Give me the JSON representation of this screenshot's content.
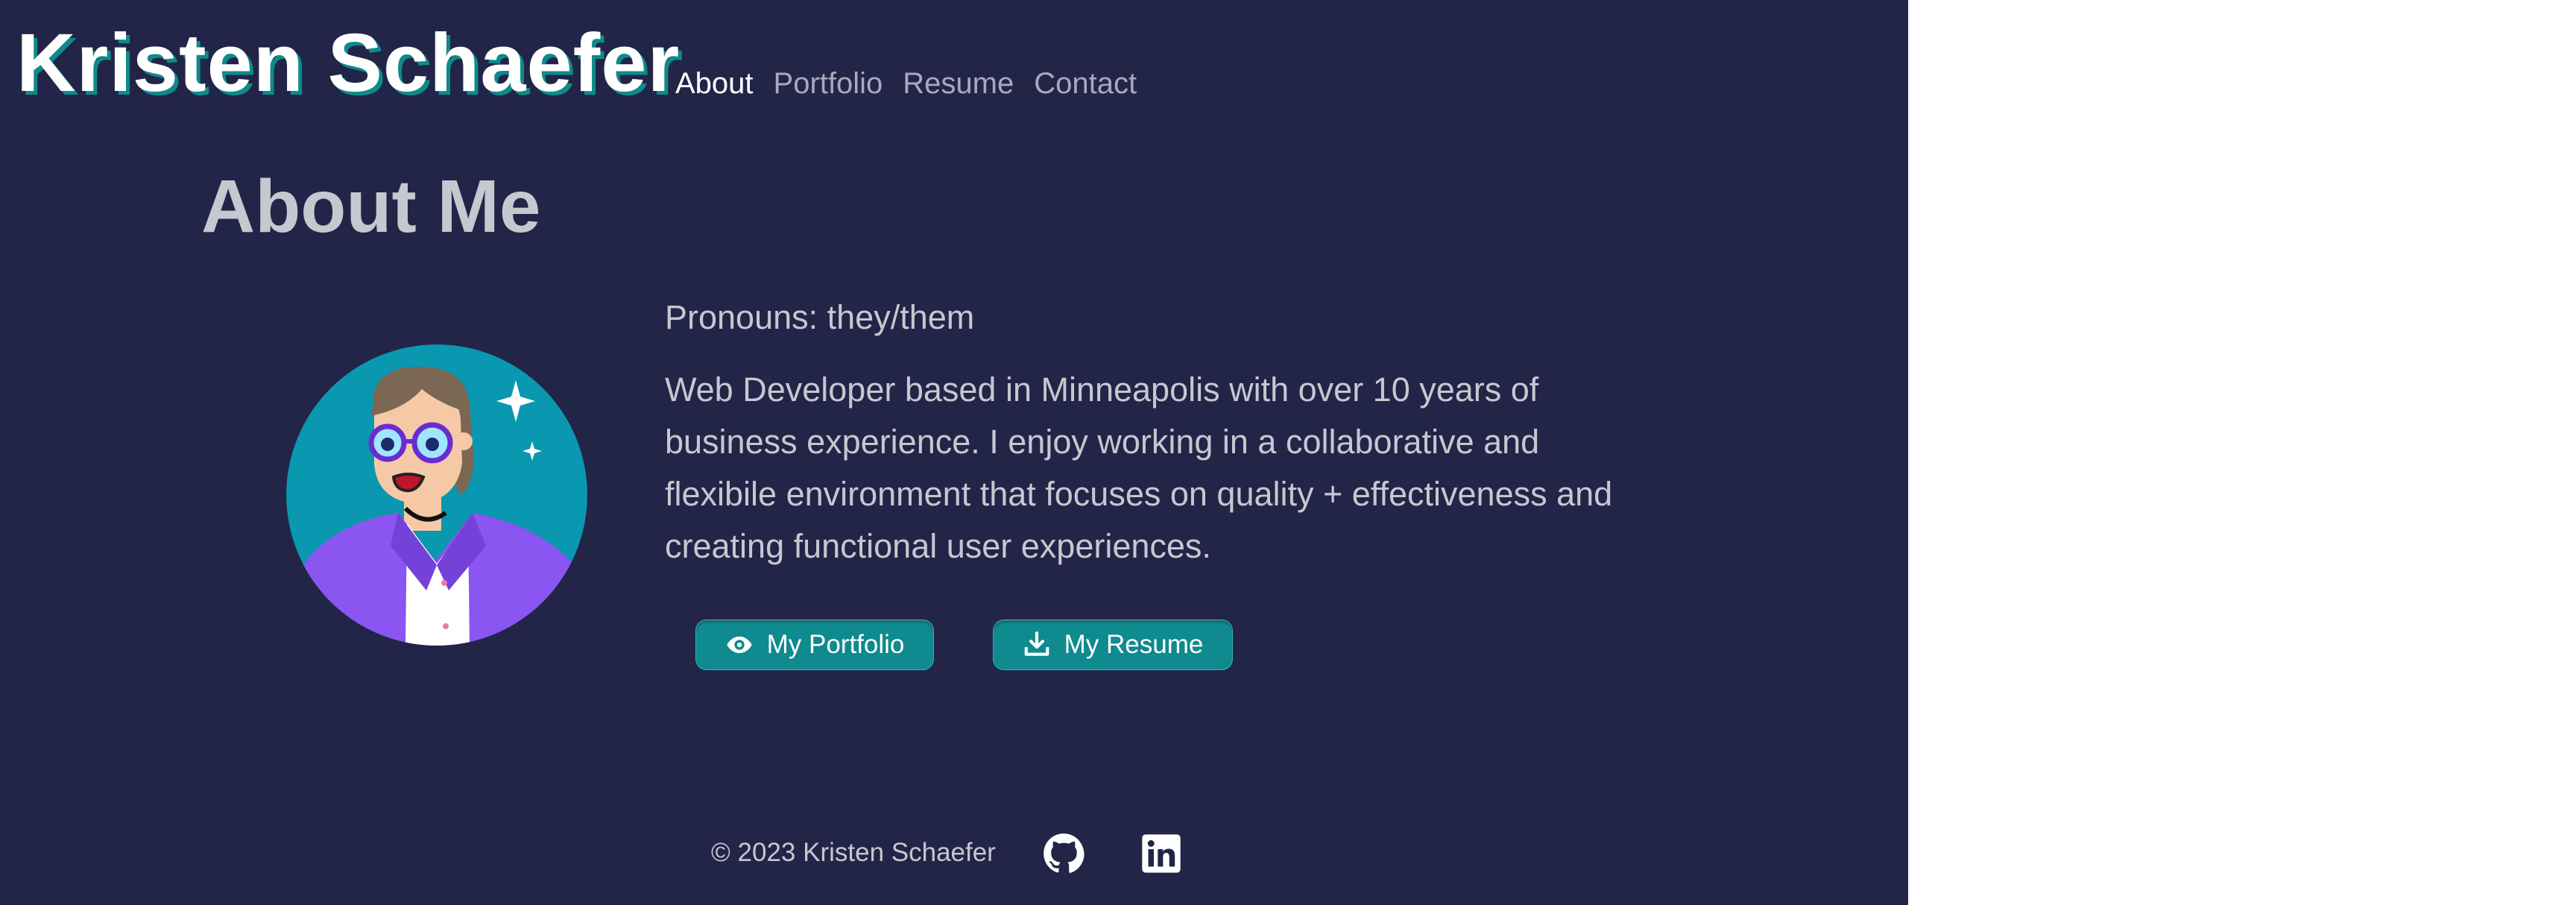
{
  "header": {
    "site_title": "Kristen Schaefer",
    "nav": [
      "About",
      "Portfolio",
      "Resume",
      "Contact"
    ],
    "active_nav": "About"
  },
  "about": {
    "title": "About Me",
    "pronouns": "Pronouns: they/them",
    "bio": "Web Developer based in Minneapolis with over 10 years of business experience. I enjoy working in a collaborative and flexibile environment that focuses on quality + effectiveness and creating functional user experiences.",
    "buttons": {
      "portfolio": {
        "label": "My Portfolio",
        "icon": "eye-icon"
      },
      "resume": {
        "label": "My Resume",
        "icon": "download-icon"
      }
    },
    "avatar_icon": "illustrated-portrait"
  },
  "footer": {
    "copyright": "© 2023 Kristen Schaefer",
    "social": [
      "github-icon",
      "linkedin-icon"
    ]
  },
  "colors": {
    "background": "#222547",
    "accent": "#0f8a8e",
    "text": "#c7c7d0",
    "title": "#ffffff",
    "avatar_bg": "#0a97b0",
    "shirt": "#8a55f0"
  }
}
